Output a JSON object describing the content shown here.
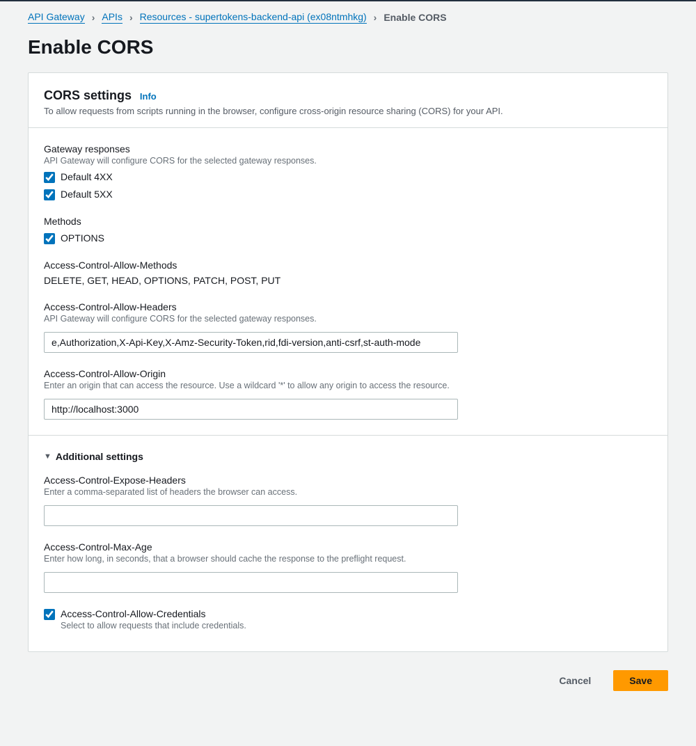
{
  "breadcrumbs": {
    "items": [
      "API Gateway",
      "APIs",
      "Resources - supertokens-backend-api (ex08ntmhkg)"
    ],
    "current": "Enable CORS"
  },
  "page": {
    "title": "Enable CORS"
  },
  "cors": {
    "header_title": "CORS settings",
    "info_label": "Info",
    "header_desc": "To allow requests from scripts running in the browser, configure cross-origin resource sharing (CORS) for your API.",
    "gateway": {
      "title": "Gateway responses",
      "hint": "API Gateway will configure CORS for the selected gateway responses.",
      "default4xx_label": "Default 4XX",
      "default5xx_label": "Default 5XX"
    },
    "methods": {
      "title": "Methods",
      "options_label": "OPTIONS"
    },
    "allow_methods": {
      "title": "Access-Control-Allow-Methods",
      "value": "DELETE, GET, HEAD, OPTIONS, PATCH, POST, PUT"
    },
    "allow_headers": {
      "title": "Access-Control-Allow-Headers",
      "hint": "API Gateway will configure CORS for the selected gateway responses.",
      "value": "e,Authorization,X-Api-Key,X-Amz-Security-Token,rid,fdi-version,anti-csrf,st-auth-mode"
    },
    "allow_origin": {
      "title": "Access-Control-Allow-Origin",
      "hint": "Enter an origin that can access the resource. Use a wildcard '*' to allow any origin to access the resource.",
      "value": "http://localhost:3000"
    },
    "additional": {
      "title": "Additional settings",
      "expose_headers": {
        "title": "Access-Control-Expose-Headers",
        "hint": "Enter a comma-separated list of headers the browser can access.",
        "value": ""
      },
      "max_age": {
        "title": "Access-Control-Max-Age",
        "hint": "Enter how long, in seconds, that a browser should cache the response to the preflight request.",
        "value": ""
      },
      "allow_credentials": {
        "label": "Access-Control-Allow-Credentials",
        "hint": "Select to allow requests that include credentials."
      }
    }
  },
  "actions": {
    "cancel": "Cancel",
    "save": "Save"
  }
}
